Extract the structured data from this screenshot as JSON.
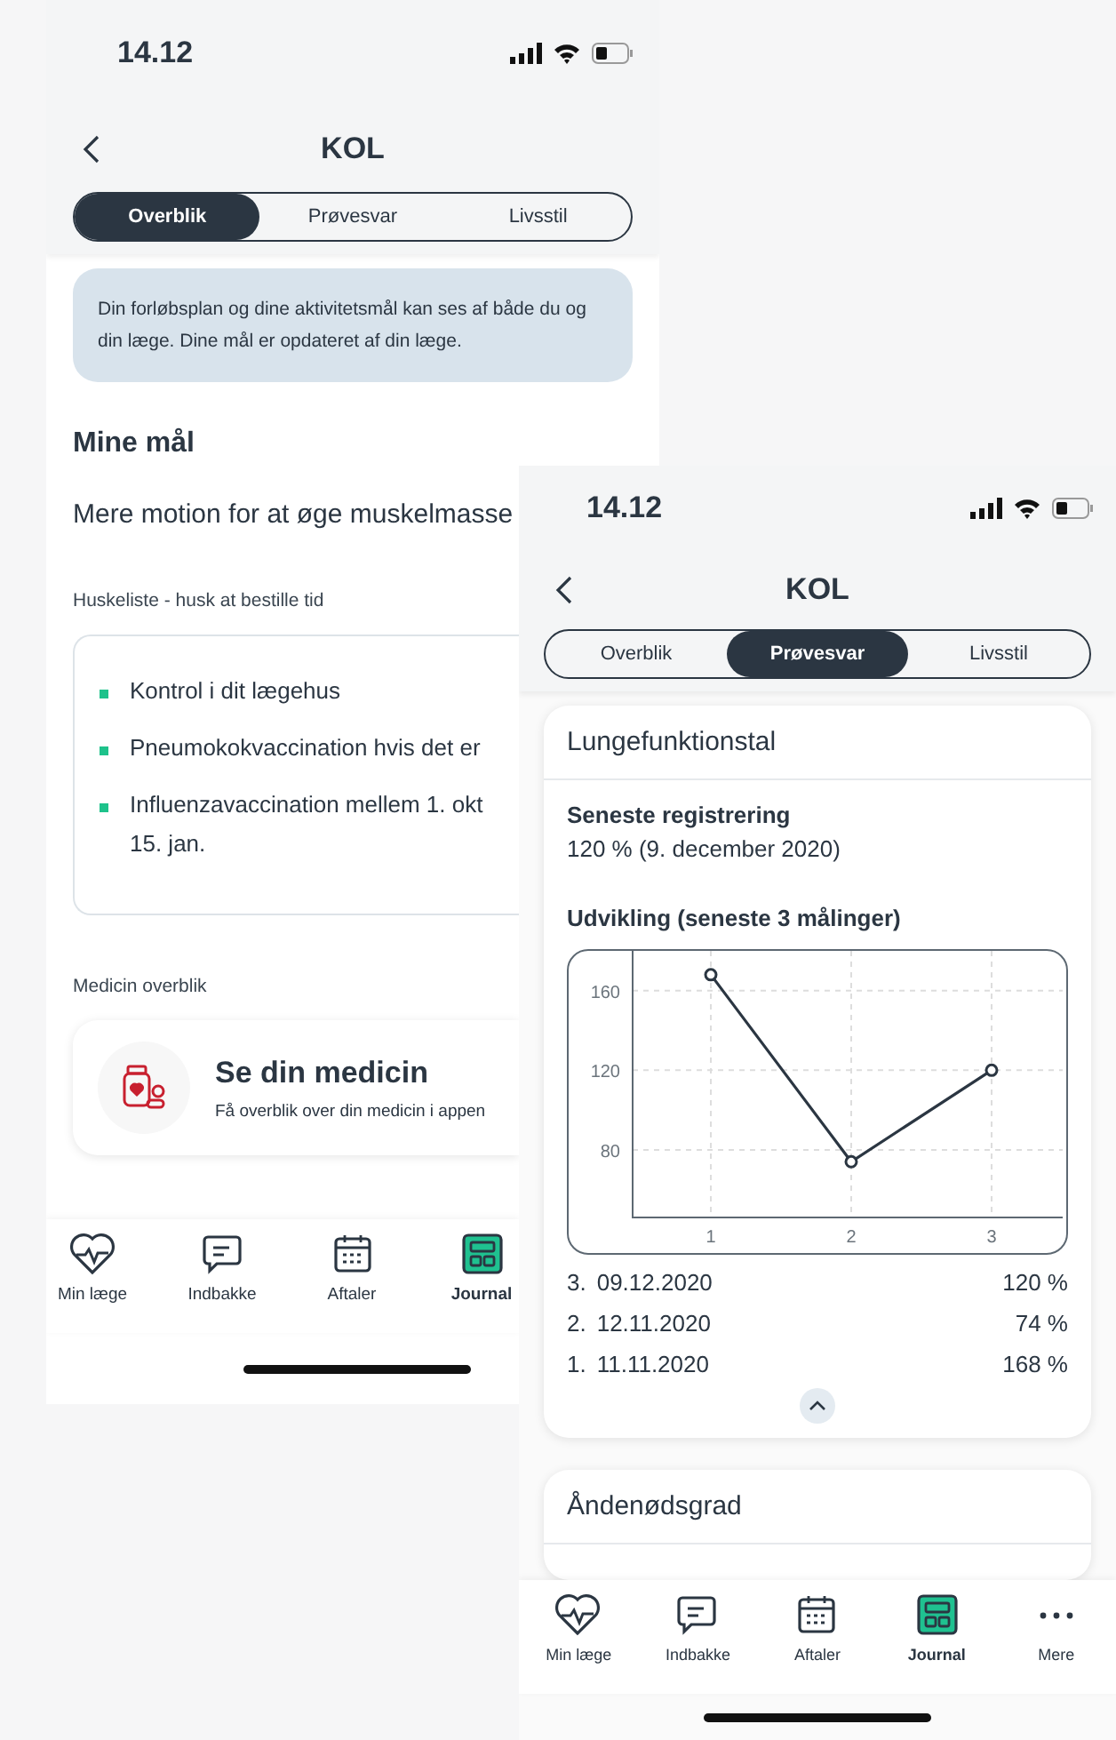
{
  "screens": [
    {
      "kind": "overview",
      "status_bar": {
        "time": "14.12"
      },
      "header": {
        "title": "KOL"
      },
      "tabs": [
        {
          "label": "Overblik",
          "selected": true
        },
        {
          "label": "Prøvesvar",
          "selected": false
        },
        {
          "label": "Livsstil",
          "selected": false
        }
      ],
      "info": "Din forløbsplan og dine aktivitetsmål kan ses af både du og din læge. Dine mål er opdateret af din læge.",
      "goals": {
        "title": "Mine mål",
        "items": [
          "Mere motion for at øge muskelmasse"
        ]
      },
      "checklist": {
        "title": "Huskeliste - husk at bestille tid",
        "items": [
          "Kontrol i dit lægehus",
          "Pneumokokvaccination hvis det er",
          "Influenzavaccination mellem 1. okt\n15. jan."
        ]
      },
      "medicine": {
        "title": "Medicin overblik",
        "card_title": "Se din medicin",
        "card_text": "Få overblik over din medicin i appen"
      },
      "nav": [
        {
          "label": "Min læge",
          "selected": false
        },
        {
          "label": "Indbakke",
          "selected": false
        },
        {
          "label": "Aftaler",
          "selected": false
        },
        {
          "label": "Journal",
          "selected": true
        }
      ]
    },
    {
      "kind": "results",
      "status_bar": {
        "time": "14.12"
      },
      "header": {
        "title": "KOL"
      },
      "tabs": [
        {
          "label": "Overblik",
          "selected": false
        },
        {
          "label": "Prøvesvar",
          "selected": true
        },
        {
          "label": "Livsstil",
          "selected": false
        }
      ],
      "cards": [
        {
          "kind": "measurement",
          "title": "Lungefunktionstal",
          "latest_label": "Seneste registrering",
          "latest_value": "120 % (9. december 2020)",
          "chart_title": "Udvikling (seneste 3 målinger)",
          "chart_data": {
            "type": "line",
            "categories": [
              "1",
              "2",
              "3"
            ],
            "series": [
              {
                "color": "#2b3642",
                "marker": "circle",
                "values": [
                  168,
                  74,
                  120
                ]
              }
            ],
            "grid": true,
            "yticks": [
              80,
              120,
              160
            ],
            "ylim": [
              46,
              180
            ]
          },
          "measurements": [
            {
              "index": "3.",
              "date": "09.12.2020",
              "value": "120 %"
            },
            {
              "index": "2.",
              "date": "12.11.2020",
              "value": "74 %"
            },
            {
              "index": "1.",
              "date": "11.11.2020",
              "value": "168 %"
            }
          ],
          "expanded": true
        },
        {
          "kind": "plain",
          "title": "Åndenødsgrad"
        }
      ],
      "nav": [
        {
          "label": "Min læge",
          "selected": false
        },
        {
          "label": "Indbakke",
          "selected": false
        },
        {
          "label": "Aftaler",
          "selected": false
        },
        {
          "label": "Journal",
          "selected": true
        },
        {
          "label": "Mere",
          "selected": false
        }
      ]
    }
  ]
}
